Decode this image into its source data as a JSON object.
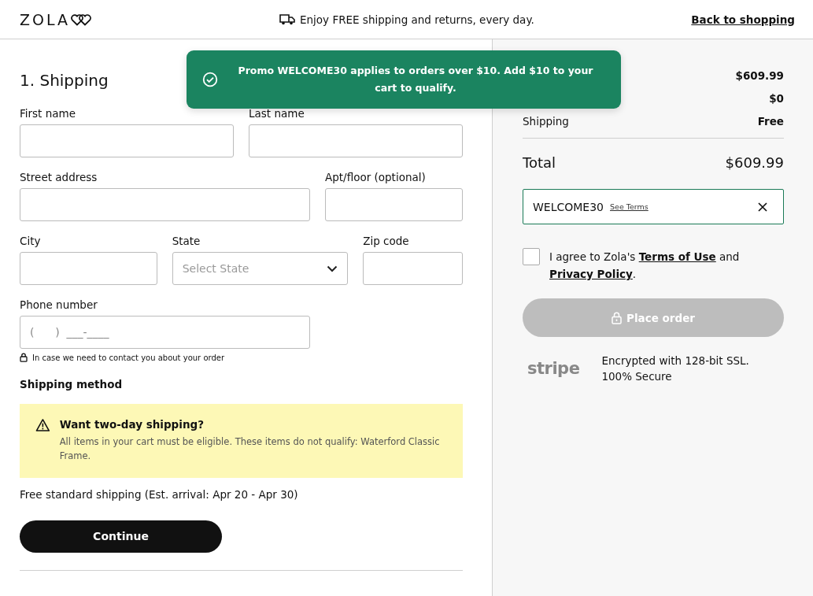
{
  "header": {
    "logo": "ZOLA",
    "promo_text": "Enjoy FREE shipping and returns, every day.",
    "back_link": "Back to shopping"
  },
  "toast": {
    "message": "Promo WELCOME30 applies to orders over $10. Add $10 to your cart to qualify."
  },
  "shipping": {
    "title": "1. Shipping",
    "fields": [
      {
        "label": "First name",
        "kind": "text"
      },
      {
        "label": "Last name",
        "kind": "text"
      },
      {
        "label": "Street address",
        "kind": "text"
      },
      {
        "label": "Apt/floor (optional)",
        "kind": "text"
      },
      {
        "label": "City",
        "kind": "text"
      },
      {
        "label": "State",
        "kind": "select",
        "placeholder": "Select State"
      },
      {
        "label": "Zip code",
        "kind": "text"
      },
      {
        "label": "Phone number",
        "kind": "phone",
        "placeholder": "(      )  ___-____"
      }
    ],
    "phone_note": "In case we need to contact you about your order",
    "method_title": "Shipping method",
    "notice": {
      "title": "Want two-day shipping?",
      "body": "All items in your cart must be eligible. These items do not qualify: Waterford Classic Frame."
    },
    "standard_shipping": "Free standard shipping (Est. arrival: Apr 20 - Apr 30)",
    "continue_button": "Continue"
  },
  "summary": {
    "rows": [
      {
        "label": "",
        "value": "$609.99"
      },
      {
        "label": "",
        "value": "$0"
      },
      {
        "label": "Shipping",
        "value": "Free"
      }
    ],
    "total_label": "Total",
    "total_value": "$609.99",
    "promo": {
      "code": "WELCOME30",
      "terms_link": "See Terms"
    },
    "agree": {
      "checked": false,
      "prefix": "I agree to Zola's ",
      "terms": "Terms of Use",
      "middle": " and ",
      "privacy": "Privacy Policy",
      "suffix": "."
    },
    "place_order": {
      "label": "Place order",
      "disabled": true
    },
    "security": {
      "brand": "stripe",
      "line1": "Encrypted with 128-bit SSL.",
      "line2": "100% Secure"
    }
  }
}
